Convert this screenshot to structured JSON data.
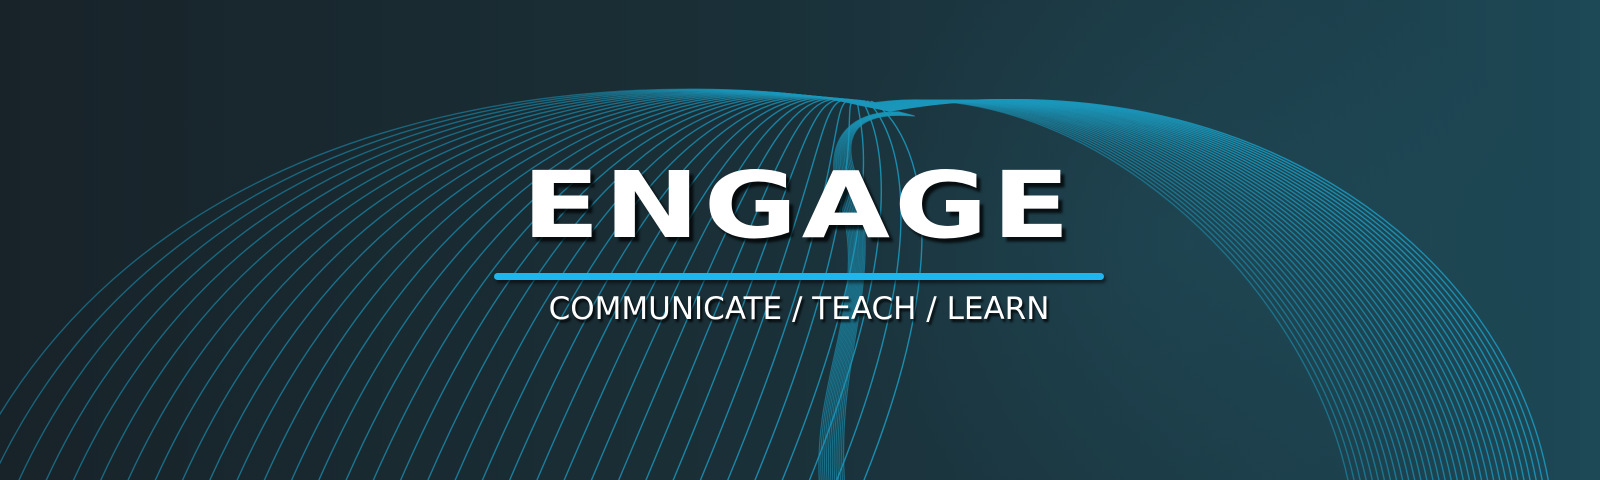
{
  "logo": {
    "title": "ENGAGE",
    "tagline": "COMMUNICATE / TEACH / LEARN"
  },
  "colors": {
    "background_dark": "#182329",
    "background_light": "#1d4856",
    "line": "#1b97bb",
    "accent_bar": "#1db6ee",
    "text": "#ffffff"
  }
}
